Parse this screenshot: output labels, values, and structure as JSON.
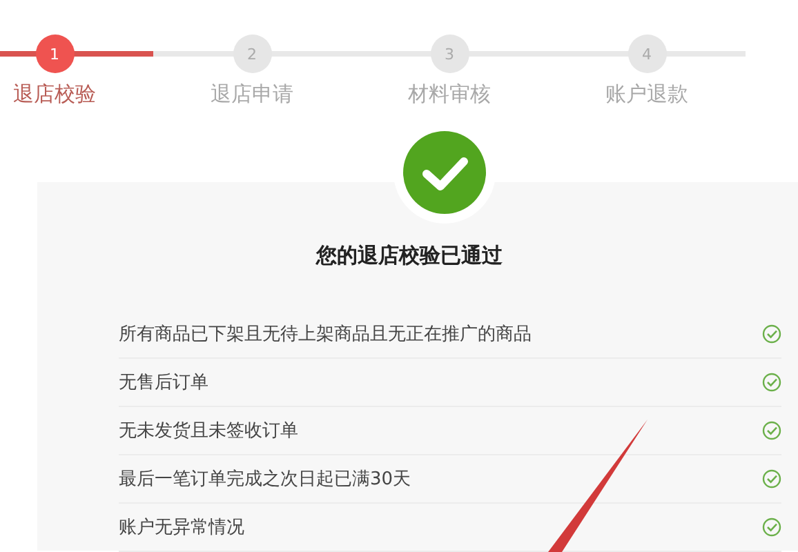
{
  "steps": [
    {
      "number": "1",
      "label": "退店校验",
      "active": true
    },
    {
      "number": "2",
      "label": "退店申请",
      "active": false
    },
    {
      "number": "3",
      "label": "材料审核",
      "active": false
    },
    {
      "number": "4",
      "label": "账户退款",
      "active": false
    }
  ],
  "result": {
    "title": "您的退店校验已通过",
    "passed": true
  },
  "checks": [
    {
      "text": "所有商品已下架且无待上架商品且无正在推广的商品",
      "passed": true
    },
    {
      "text": "无售后订单",
      "passed": true
    },
    {
      "text": "无未发货且未签收订单",
      "passed": true
    },
    {
      "text": "最后一笔订单完成之次日起已满30天",
      "passed": true
    },
    {
      "text": "账户无异常情况",
      "passed": true
    }
  ]
}
